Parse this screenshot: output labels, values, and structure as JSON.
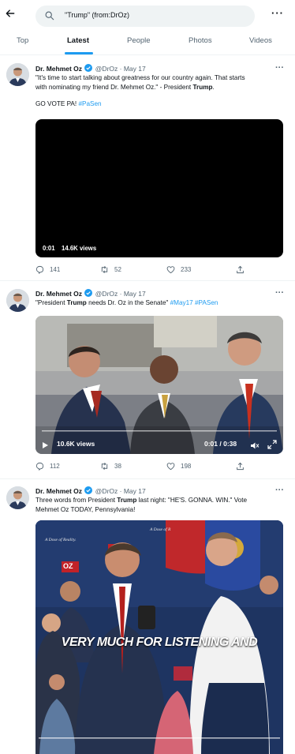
{
  "search": {
    "query": "\"Trump\" (from:DrOz)"
  },
  "tabs": [
    "Top",
    "Latest",
    "People",
    "Photos",
    "Videos"
  ],
  "tweets": [
    {
      "name": "Dr. Mehmet Oz",
      "handle": "@DrOz",
      "date": "May 17",
      "text_line1_a": "\"It's time to start talking about greatness for our country again. That starts",
      "text_line2_a": "with nominating my friend Dr. Mehmet Oz.\" - President ",
      "text_line2_b": "Trump",
      "text_line2_c": ".",
      "text_line3_a": "GO VOTE PA! ",
      "text_line3_tag": "#PaSen",
      "video_time": "0:01",
      "video_views": "14.6K views",
      "replies": "141",
      "retweets": "52",
      "likes": "233"
    },
    {
      "name": "Dr. Mehmet Oz",
      "handle": "@DrOz",
      "date": "May 17",
      "text_a": "\"President ",
      "text_b": "Trump",
      "text_c": " needs Dr. Oz in the Senate\" ",
      "tag1": "#May17",
      "tag2": "#PASen",
      "video_views": "10.6K views",
      "video_time": "0:01 / 0:38",
      "replies": "112",
      "retweets": "38",
      "likes": "198"
    },
    {
      "name": "Dr. Mehmet Oz",
      "handle": "@DrOz",
      "date": "May 17",
      "text_line1_a": "Three words from President ",
      "text_line1_b": "Trump",
      "text_line1_c": " last night: \"HE'S. GONNA. WIN.\" Vote",
      "text_line2": "Mehmet Oz TODAY, Pennsylvania!",
      "caption": "VERY MUCH FOR LISTENING AND",
      "sign_oz": "OZ",
      "banner_left": "A Dose of Reality.",
      "banner_mid": "A Dose of R"
    }
  ]
}
